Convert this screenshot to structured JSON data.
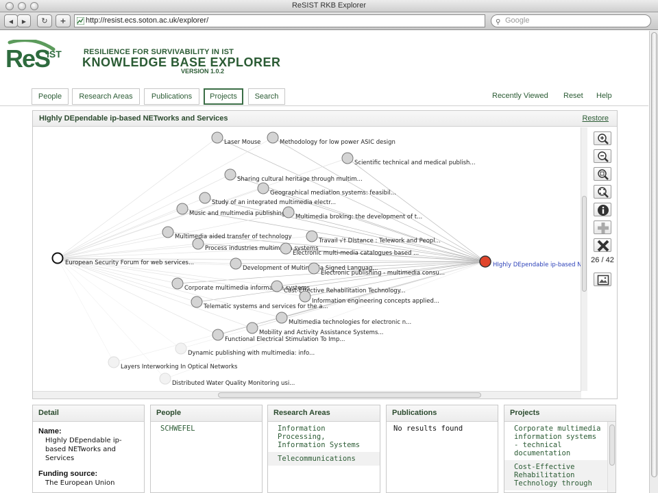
{
  "window": {
    "title": "ReSIST RKB Explorer"
  },
  "toolbar": {
    "url": "http://resist.ecs.soton.ac.uk/explorer/",
    "search_placeholder": "Google",
    "back_glyph": "◀",
    "forward_glyph": "▶",
    "reload_glyph": "↻",
    "add_glyph": "+"
  },
  "header": {
    "logo_text": "ReS",
    "logo_suffix": "IST",
    "line1": "RESILIENCE FOR SURVIVABILITY IN IST",
    "line2": "KNOWLEDGE BASE EXPLORER",
    "version": "VERSION 1.0.2"
  },
  "nav": {
    "tabs": [
      "People",
      "Research Areas",
      "Publications",
      "Projects",
      "Search"
    ],
    "active": "Projects",
    "right_links": [
      "Recently Viewed",
      "Reset",
      "Help"
    ]
  },
  "graph_panel": {
    "title": "HIghly DEpendable ip-based NETworks and Services",
    "restore_label": "Restore",
    "page_count": "26 / 42",
    "center_node": "European Security Forum for web services...",
    "focus_node": "HIghly DEpendable ip-based N",
    "nodes": [
      "Laser Mouse",
      "Methodology for low power ASIC design",
      "Scientific technical and medical publish...",
      "Sharing cultural heritage through multim...",
      "Geographical mediation systems: feasibil...",
      "Study of an integrated multimedia electr...",
      "Music and multimedia publishing",
      "Multimedia broking: the development of t...",
      "Multimedia aided transfer of technology",
      "Travail √† Distance : Telework and Peopl...",
      "Process industries multimedia systems",
      "Electronic multi-media catalogues based ...",
      "Development of Multimedia Signed Languag...",
      "Electronic publishing - multimedia consu...",
      "Corporate multimedia information systems",
      "Cost-Effective Rehabilitation Technology...",
      "Information engineering concepts applied...",
      "Telematic systems and services for the a...",
      "Multimedia technologies for electronic n...",
      "Mobility and Activity Assistance Systems...",
      "Functional Electrical Stimulation To Imp...",
      "Dynamic publishing with multimedia: info...",
      "Layers Interworking In Optical Networks",
      "Distributed Water Quality Monitoring usi..."
    ],
    "colors": {
      "focus_node": "#e0452c",
      "focus_label": "#2a3fb8",
      "node_fill": "#d4d4d4",
      "faded_node": "#f2f2f2"
    }
  },
  "detail": {
    "title": "Detail",
    "name_label": "Name:",
    "name_value": "HIghly DEpendable ip-based NETworks and Services",
    "funding_label": "Funding source:",
    "funding_value": "The European Union"
  },
  "people": {
    "title": "People",
    "items": [
      "SCHWEFEL"
    ]
  },
  "research_areas": {
    "title": "Research Areas",
    "items": [
      "Information Processing, Information Systems",
      "Telecommunications"
    ]
  },
  "publications": {
    "title": "Publications",
    "empty_text": "No results found"
  },
  "projects": {
    "title": "Projects",
    "items": [
      "Corporate multimedia information systems - technical documentation",
      "Cost-Effective Rehabilitation Technology through"
    ]
  }
}
